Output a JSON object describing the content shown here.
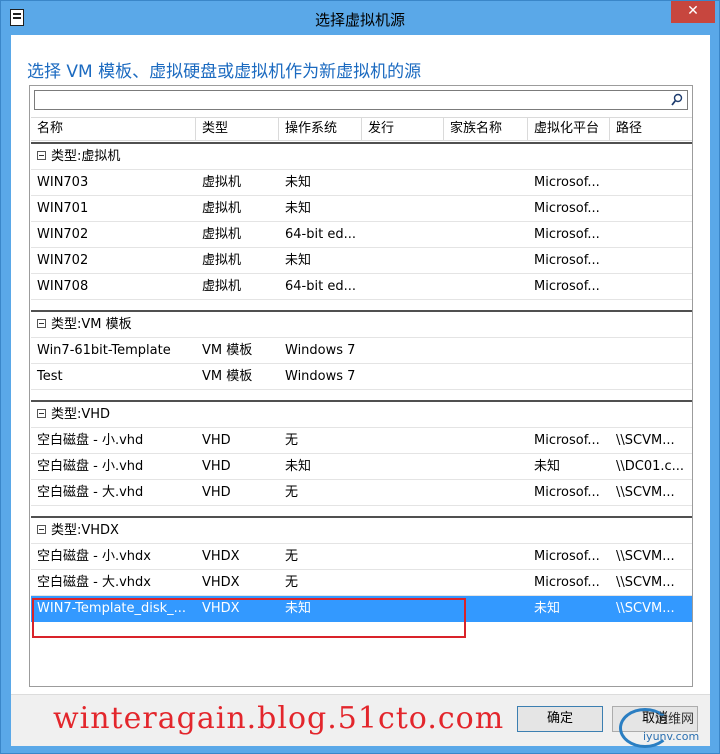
{
  "window": {
    "title": "选择虚拟机源",
    "close_label": "✕"
  },
  "heading": "选择 VM 模板、虚拟硬盘或虚拟机作为新虚拟机的源",
  "search": {
    "value": "",
    "placeholder": ""
  },
  "columns": [
    "名称",
    "类型",
    "操作系统",
    "发行",
    "家族名称",
    "虚拟化平台",
    "路径"
  ],
  "groups": [
    {
      "label": "类型:虚拟机",
      "rows": [
        [
          "WIN703",
          "虚拟机",
          "未知",
          "",
          "",
          "Microsof...",
          ""
        ],
        [
          "WIN701",
          "虚拟机",
          "未知",
          "",
          "",
          "Microsof...",
          ""
        ],
        [
          "WIN702",
          "虚拟机",
          "64-bit ed...",
          "",
          "",
          "Microsof...",
          ""
        ],
        [
          "WIN702",
          "虚拟机",
          "未知",
          "",
          "",
          "Microsof...",
          ""
        ],
        [
          "WIN708",
          "虚拟机",
          "64-bit ed...",
          "",
          "",
          "Microsof...",
          ""
        ]
      ]
    },
    {
      "label": "类型:VM 模板",
      "rows": [
        [
          "Win7-61bit-Template",
          "VM 模板",
          "Windows 7",
          "",
          "",
          "",
          ""
        ],
        [
          "Test",
          "VM 模板",
          "Windows 7",
          "",
          "",
          "",
          ""
        ]
      ]
    },
    {
      "label": "类型:VHD",
      "rows": [
        [
          "空白磁盘 - 小.vhd",
          "VHD",
          "无",
          "",
          "",
          "Microsof...",
          "\\\\SCVM..."
        ],
        [
          "空白磁盘 - 小.vhd",
          "VHD",
          "未知",
          "",
          "",
          "未知",
          "\\\\DC01.c..."
        ],
        [
          "空白磁盘 - 大.vhd",
          "VHD",
          "无",
          "",
          "",
          "Microsof...",
          "\\\\SCVM..."
        ]
      ]
    },
    {
      "label": "类型:VHDX",
      "rows": [
        [
          "空白磁盘 - 小.vhdx",
          "VHDX",
          "无",
          "",
          "",
          "Microsof...",
          "\\\\SCVM..."
        ],
        [
          "空白磁盘 - 大.vhdx",
          "VHDX",
          "无",
          "",
          "",
          "Microsof...",
          "\\\\SCVM..."
        ],
        [
          "WIN7-Template_disk_...",
          "VHDX",
          "未知",
          "",
          "",
          "未知",
          "\\\\SCVM..."
        ]
      ]
    }
  ],
  "selected_row": "WIN7-Template_disk_...",
  "footer": {
    "ok_label": "确定",
    "cancel_label": "取消"
  },
  "watermark": "winteragain.blog.51cto.com",
  "logo": {
    "line1": "运维网",
    "line2": "iyunv.com"
  },
  "colors": {
    "accent": "#1b6ac0",
    "selection": "#3399ff",
    "frame": "#5aa8e8",
    "highlight": "#d9232a"
  }
}
